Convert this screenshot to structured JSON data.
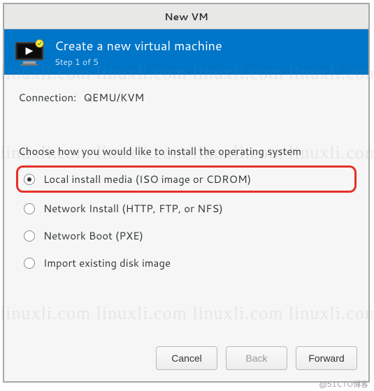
{
  "window": {
    "title": "New VM"
  },
  "header": {
    "title": "Create a new virtual machine",
    "step": "Step 1 of 5"
  },
  "connection": {
    "label": "Connection:",
    "value": "QEMU/KVM"
  },
  "choose_label": "Choose how you would like to install the operating system",
  "radios": [
    {
      "label": "Local install media (ISO image or CDROM)",
      "checked": true,
      "highlight": true
    },
    {
      "label": "Network Install (HTTP, FTP, or NFS)",
      "checked": false,
      "highlight": false
    },
    {
      "label": "Network Boot (PXE)",
      "checked": false,
      "highlight": false
    },
    {
      "label": "Import existing disk image",
      "checked": false,
      "highlight": false
    }
  ],
  "buttons": {
    "cancel": "Cancel",
    "back": "Back",
    "forward": "Forward"
  },
  "watermark": "linuxli.com",
  "attribution": "@51CTO博客"
}
